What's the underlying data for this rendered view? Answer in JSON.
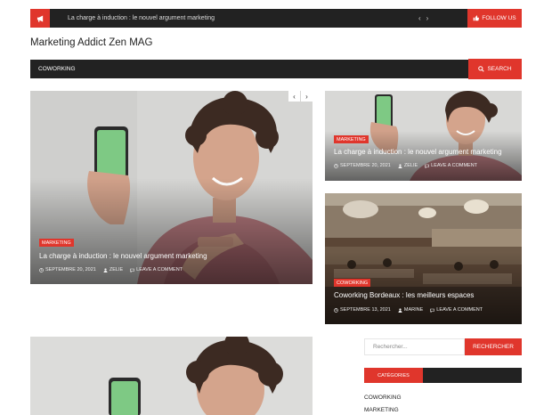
{
  "topbar": {
    "ticker_text": "La charge à induction : le nouvel argument marketing",
    "nav_prev": "‹",
    "nav_next": "›",
    "follow_label": "FOLLOW US"
  },
  "site": {
    "title": "Marketing Addict Zen MAG"
  },
  "nav": {
    "items": [
      {
        "label": "COWORKING"
      }
    ],
    "search_label": "SEARCH"
  },
  "slider": {
    "prev": "‹",
    "next": "›"
  },
  "featured": {
    "main": {
      "category": "MARKETING",
      "title": "La charge à induction : le nouvel argument marketing",
      "date": "SEPTEMBRE 20, 2021",
      "author": "ZELIE",
      "comments": "LEAVE A COMMENT"
    },
    "top_right": {
      "category": "MARKETING",
      "title": "La charge à induction : le nouvel argument marketing",
      "date": "SEPTEMBRE 20, 2021",
      "author": "ZELIE",
      "comments": "LEAVE A COMMENT"
    },
    "bottom_right": {
      "category": "COWORKING",
      "title": "Coworking Bordeaux : les meilleurs espaces",
      "date": "SEPTEMBRE 13, 2021",
      "author": "MARINE",
      "comments": "LEAVE A COMMENT"
    }
  },
  "sidebar": {
    "search_placeholder": "Rechercher...",
    "search_button": "RECHERCHER",
    "categories_title": "CATÉGORIES",
    "categories": [
      "COWORKING",
      "MARKETING"
    ]
  },
  "colors": {
    "accent": "#e0362c",
    "dark": "#222222"
  },
  "icons": {
    "ticker": "megaphone-icon",
    "follow": "thumbs-up-icon",
    "search": "search-icon",
    "date": "clock-icon",
    "author": "user-icon",
    "comments": "comment-icon"
  }
}
